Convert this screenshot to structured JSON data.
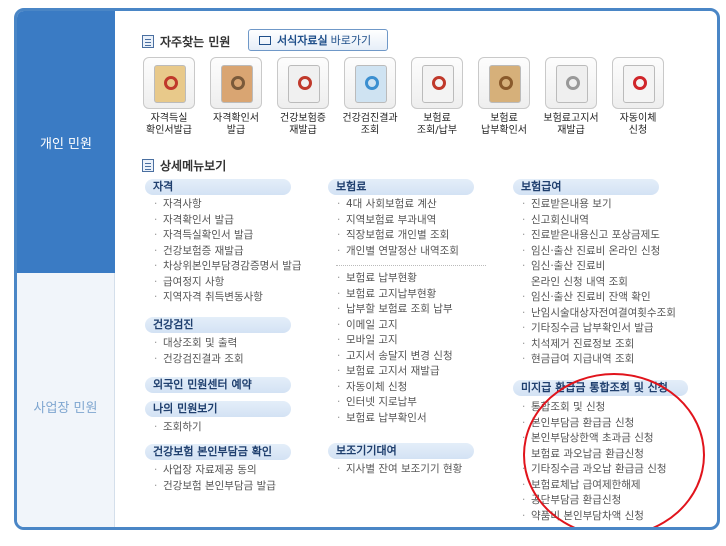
{
  "sidebar": {
    "personal": "개인 민원",
    "business": "사업장 민원"
  },
  "frequent_title": "자주찾는 민원",
  "form_link": {
    "bold": "서식자료실",
    "rest": "바로가기"
  },
  "quick": [
    {
      "label": "자격득실\n확인서발급",
      "icon": "certificate-icon"
    },
    {
      "label": "자격확인서\n발급",
      "icon": "document-clipboard-icon"
    },
    {
      "label": "건강보험증\n재발급",
      "icon": "insurance-card-icon"
    },
    {
      "label": "건강검진결과\n조회",
      "icon": "health-checkup-icon"
    },
    {
      "label": "보험료\n조회/납부",
      "icon": "bar-chart-icon"
    },
    {
      "label": "보험료\n납부확인서",
      "icon": "books-icon"
    },
    {
      "label": "보험료고지서\n재발급",
      "icon": "receipt-icon"
    },
    {
      "label": "자동이체\n신청",
      "icon": "refresh-arrows-icon"
    }
  ],
  "detail_title": "상세메뉴보기",
  "col1": {
    "cat1": "자격",
    "items1": [
      "자격사항",
      "자격확인서 발급",
      "자격득실확인서 발급",
      "건강보험증 재발급",
      "차상위본인부담경감증명서 발급",
      "급여정지 사항",
      "지역자격 취득변동사항"
    ],
    "cat2": "건강검진",
    "items2": [
      "대상조회 및 출력",
      "건강검진결과 조회"
    ],
    "cat3": "외국인 민원센터 예약",
    "cat4": "나의 민원보기",
    "items4": [
      "조회하기"
    ],
    "cat5": "건강보험 본인부담금 확인",
    "items5": [
      "사업장 자료제공 동의",
      "건강보험 본인부담금 발급"
    ]
  },
  "col2": {
    "cat1": "보험료",
    "items1": [
      "4대 사회보험료 계산",
      "지역보험료 부과내역",
      "직장보험료 개인별 조회",
      "개인별 연말정산 내역조회"
    ],
    "items1b": [
      "보험료 납부현황",
      "보험료 고지납부현황",
      "납부할 보험료 조회 납부",
      "이메일 고지",
      "모바일 고지",
      "고지서 송달지 변경 신청",
      "보험료 고지서 재발급",
      "자동이체 신청",
      "인터넷 지로납부",
      "보험료 납부확인서"
    ],
    "cat2": "보조기기대여",
    "items2": [
      "지사별 잔여 보조기기 현황"
    ]
  },
  "col3": {
    "cat1": "보험급여",
    "items1": [
      "진료받은내용 보기",
      "신고회신내역",
      "진료받은내용신고 포상금제도",
      "임신·출산 진료비 온라인 신청",
      "임신·출산 진료비",
      "온라인 신청 내역 조회",
      "임신·출산 진료비 잔액 확인",
      "난임시술대상자전여결여횟수조회",
      "기타징수금 납부확인서 발급",
      "치석제거 진료정보 조회",
      "현금급여 지급내역 조회"
    ],
    "cat2": "미지급 환급금 통합조회 및 신청",
    "items2": [
      "통합조회 및 신청",
      "본인부담금 환급금 신청",
      "본인부담상한액 초과금 신청",
      "보험료 과오납금 환급신청",
      "기타징수금 과오납 환급금 신청",
      "보험료체납 급여제한해제",
      "공단부담금 환급신청",
      "약품비 본인부담차액 신청"
    ]
  },
  "colors": {
    "accent": "#3a7bc4",
    "highlight": "#e1141c"
  }
}
